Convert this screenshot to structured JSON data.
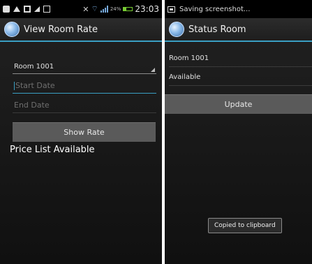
{
  "left": {
    "status": {
      "time": "23:03",
      "battery_text": "24%"
    },
    "action_bar": {
      "title": "View Room Rate"
    },
    "room_spinner": {
      "value": "Room 1001"
    },
    "start_date": {
      "placeholder": "Start Date"
    },
    "end_date": {
      "placeholder": "End Date"
    },
    "show_rate_button": {
      "label": "Show Rate"
    },
    "price_text": "Price List Available"
  },
  "right": {
    "status": {
      "notification": "Saving screenshot..."
    },
    "action_bar": {
      "title": "Status Room"
    },
    "room_label": "Room 1001",
    "status_label": "Available",
    "update_button": {
      "label": "Update"
    },
    "toast": "Copied to clipboard"
  },
  "colors": {
    "accent": "#3aa0c4",
    "button": "#5a5a5a"
  }
}
